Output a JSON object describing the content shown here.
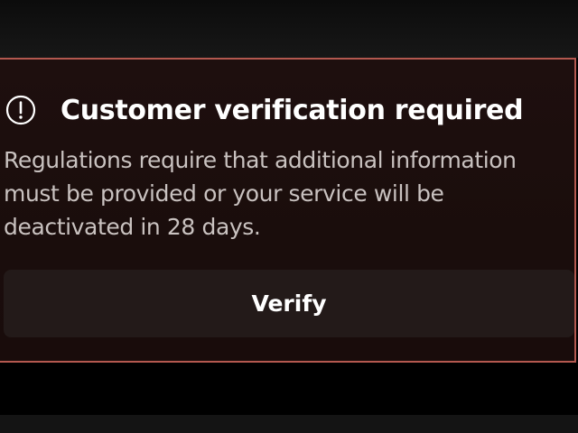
{
  "alert": {
    "icon": "alert-circle-icon",
    "title": "Customer verification required",
    "message": "Regulations require that additional information must be provided or your service will be deactivated in 28 days.",
    "action_label": "Verify"
  },
  "colors": {
    "card_border": "#b4584f",
    "card_background": "#1c0e0d",
    "button_background": "#231a19",
    "title_text": "#ffffff",
    "message_text": "#c9c2c0"
  }
}
